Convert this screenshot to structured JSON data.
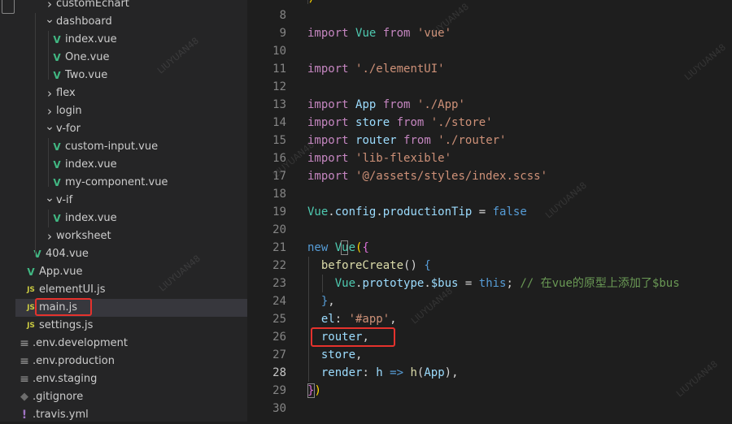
{
  "explorer": {
    "items": [
      {
        "label": "customEchart",
        "type": "folder",
        "open": false
      },
      {
        "label": "dashboard",
        "type": "folder",
        "open": true
      },
      {
        "label": "index.vue",
        "type": "vue"
      },
      {
        "label": "One.vue",
        "type": "vue"
      },
      {
        "label": "Two.vue",
        "type": "vue"
      },
      {
        "label": "flex",
        "type": "folder",
        "open": false
      },
      {
        "label": "login",
        "type": "folder",
        "open": false
      },
      {
        "label": "v-for",
        "type": "folder",
        "open": true
      },
      {
        "label": "custom-input.vue",
        "type": "vue"
      },
      {
        "label": "index.vue",
        "type": "vue"
      },
      {
        "label": "my-component.vue",
        "type": "vue"
      },
      {
        "label": "v-if",
        "type": "folder",
        "open": true
      },
      {
        "label": "index.vue",
        "type": "vue"
      },
      {
        "label": "worksheet",
        "type": "folder",
        "open": false
      },
      {
        "label": "404.vue",
        "type": "vue"
      },
      {
        "label": "App.vue",
        "type": "vue"
      },
      {
        "label": "elementUI.js",
        "type": "js"
      },
      {
        "label": "main.js",
        "type": "js",
        "selected": true
      },
      {
        "label": "settings.js",
        "type": "js"
      },
      {
        "label": ".env.development",
        "type": "env"
      },
      {
        "label": ".env.production",
        "type": "env"
      },
      {
        "label": ".env.staging",
        "type": "env"
      },
      {
        "label": ".gitignore",
        "type": "git"
      },
      {
        "label": ".travis.yml",
        "type": "yml"
      }
    ],
    "icon_glyphs": {
      "vue": "V",
      "js": "JS",
      "env": "≡",
      "git": "◆",
      "yml": "!"
    }
  },
  "editor": {
    "active_line": "28",
    "lines": [
      {
        "n": "8",
        "tokens": []
      },
      {
        "n": "9",
        "tokens": [
          [
            "kw",
            "import "
          ],
          [
            "id",
            "Vue "
          ],
          [
            "kw",
            "from "
          ],
          [
            "str",
            "'vue'"
          ]
        ]
      },
      {
        "n": "10",
        "tokens": []
      },
      {
        "n": "11",
        "tokens": [
          [
            "kw",
            "import "
          ],
          [
            "str",
            "'./elementUI'"
          ]
        ]
      },
      {
        "n": "12",
        "tokens": []
      },
      {
        "n": "13",
        "tokens": [
          [
            "kw",
            "import "
          ],
          [
            "var",
            "App "
          ],
          [
            "kw",
            "from "
          ],
          [
            "str",
            "'./App'"
          ]
        ]
      },
      {
        "n": "14",
        "tokens": [
          [
            "kw",
            "import "
          ],
          [
            "var",
            "store "
          ],
          [
            "kw",
            "from "
          ],
          [
            "str",
            "'./store'"
          ]
        ]
      },
      {
        "n": "15",
        "tokens": [
          [
            "kw",
            "import "
          ],
          [
            "var",
            "router "
          ],
          [
            "kw",
            "from "
          ],
          [
            "str",
            "'./router'"
          ]
        ]
      },
      {
        "n": "16",
        "tokens": [
          [
            "kw",
            "import "
          ],
          [
            "str",
            "'lib-flexible'"
          ]
        ]
      },
      {
        "n": "17",
        "tokens": [
          [
            "kw",
            "import "
          ],
          [
            "str",
            "'@/assets/styles/index.scss'"
          ]
        ]
      },
      {
        "n": "18",
        "tokens": []
      },
      {
        "n": "19",
        "tokens": [
          [
            "id",
            "Vue"
          ],
          [
            "pl",
            "."
          ],
          [
            "var",
            "config"
          ],
          [
            "pl",
            "."
          ],
          [
            "var",
            "productionTip"
          ],
          [
            "pl",
            " = "
          ],
          [
            "decl",
            "false"
          ]
        ]
      },
      {
        "n": "20",
        "tokens": []
      },
      {
        "n": "21",
        "tokens": [
          [
            "decl",
            "new "
          ],
          [
            "id",
            "Vue"
          ],
          [
            "br",
            "("
          ],
          [
            "br2",
            "{"
          ]
        ]
      },
      {
        "n": "22",
        "tokens": [
          [
            "pl",
            "  "
          ],
          [
            "fn",
            "beforeCreate"
          ],
          [
            "pl",
            "() "
          ],
          [
            "decl",
            "{"
          ]
        ]
      },
      {
        "n": "23",
        "tokens": [
          [
            "pl",
            "    "
          ],
          [
            "id",
            "Vue"
          ],
          [
            "pl",
            "."
          ],
          [
            "var",
            "prototype"
          ],
          [
            "pl",
            "."
          ],
          [
            "var",
            "$bus"
          ],
          [
            "pl",
            " = "
          ],
          [
            "decl",
            "this"
          ],
          [
            "pl",
            "; "
          ],
          [
            "cm",
            "// 在vue的原型上添加了$bus"
          ]
        ]
      },
      {
        "n": "24",
        "tokens": [
          [
            "pl",
            "  "
          ],
          [
            "decl",
            "}"
          ],
          [
            "pl",
            ","
          ]
        ]
      },
      {
        "n": "25",
        "tokens": [
          [
            "pl",
            "  "
          ],
          [
            "var",
            "el"
          ],
          [
            "pl",
            ": "
          ],
          [
            "str",
            "'#app'"
          ],
          [
            "pl",
            ","
          ]
        ]
      },
      {
        "n": "26",
        "tokens": [
          [
            "pl",
            "  "
          ],
          [
            "var",
            "router"
          ],
          [
            "pl",
            ","
          ]
        ]
      },
      {
        "n": "27",
        "tokens": [
          [
            "pl",
            "  "
          ],
          [
            "var",
            "store"
          ],
          [
            "pl",
            ","
          ]
        ]
      },
      {
        "n": "28",
        "tokens": [
          [
            "pl",
            "  "
          ],
          [
            "var",
            "render"
          ],
          [
            "pl",
            ": "
          ],
          [
            "var",
            "h"
          ],
          [
            "pl",
            " "
          ],
          [
            "decl",
            "=>"
          ],
          [
            "pl",
            " "
          ],
          [
            "fn",
            "h"
          ],
          [
            "pl",
            "("
          ],
          [
            "var",
            "App"
          ],
          [
            "pl",
            "),"
          ]
        ]
      },
      {
        "n": "29",
        "tokens": [
          [
            "br2",
            "}"
          ],
          [
            "br",
            ")"
          ]
        ]
      },
      {
        "n": "30",
        "tokens": []
      }
    ]
  },
  "watermark": "LIUYUAN48"
}
